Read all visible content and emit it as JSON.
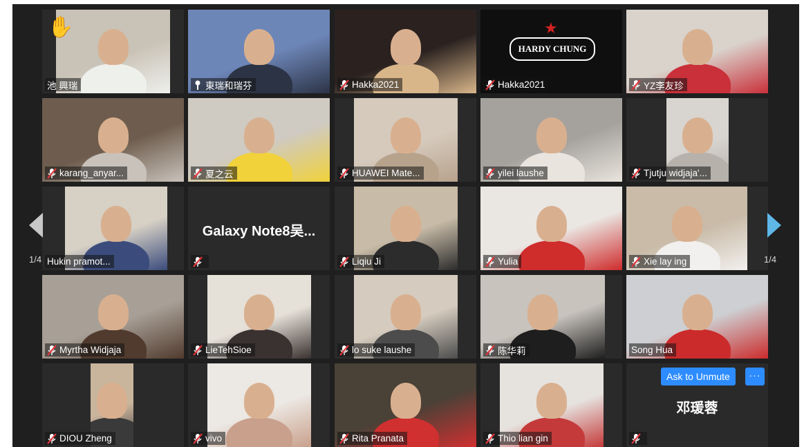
{
  "meeting": {
    "page_left": "1/4",
    "page_right": "1/4",
    "ask_to_unmute": "Ask to Unmute",
    "more_label": "···",
    "hand_icon": "raised-hand-icon"
  },
  "colors": {
    "accent": "#2d8cff",
    "active_border": "#e7e35a",
    "muted_icon": "#e0353b"
  },
  "participants": [
    {
      "name": "池 興瑞",
      "muted": false,
      "hand": true
    },
    {
      "name": "東瑞和瑞芬",
      "muted": false,
      "active": true
    },
    {
      "name": "Hakka2021",
      "muted": true
    },
    {
      "name": "Hakka2021",
      "muted": true,
      "logo": "HARDY CHUNG"
    },
    {
      "name": "YZ李友珍",
      "muted": true
    },
    {
      "name": "karang_anyar...",
      "muted": true
    },
    {
      "name": "夏之云",
      "muted": true
    },
    {
      "name": "HUAWEI Mate...",
      "muted": true
    },
    {
      "name": "yilei laushe",
      "muted": true
    },
    {
      "name": "Tjutju widjaja'...",
      "muted": true
    },
    {
      "name": "Hukin pramot...",
      "muted": false
    },
    {
      "name": "",
      "muted": true,
      "display_name": "Galaxy  Note8吴..."
    },
    {
      "name": "Liqiu Ji",
      "muted": true
    },
    {
      "name": "Yulia",
      "muted": true
    },
    {
      "name": "Xie lay ing",
      "muted": true
    },
    {
      "name": "Myrtha Widjaja",
      "muted": true
    },
    {
      "name": "LieTehSioe",
      "muted": true
    },
    {
      "name": "lo suke laushe",
      "muted": true
    },
    {
      "name": "陈华莉",
      "muted": true
    },
    {
      "name": "Song Hua",
      "muted": false
    },
    {
      "name": "DIOU Zheng",
      "muted": true
    },
    {
      "name": "vivo",
      "muted": true
    },
    {
      "name": "Rita Pranata",
      "muted": true
    },
    {
      "name": "Thio lian gin",
      "muted": true
    },
    {
      "name": "",
      "muted": true,
      "display_name": "邓瑗蓉"
    }
  ]
}
